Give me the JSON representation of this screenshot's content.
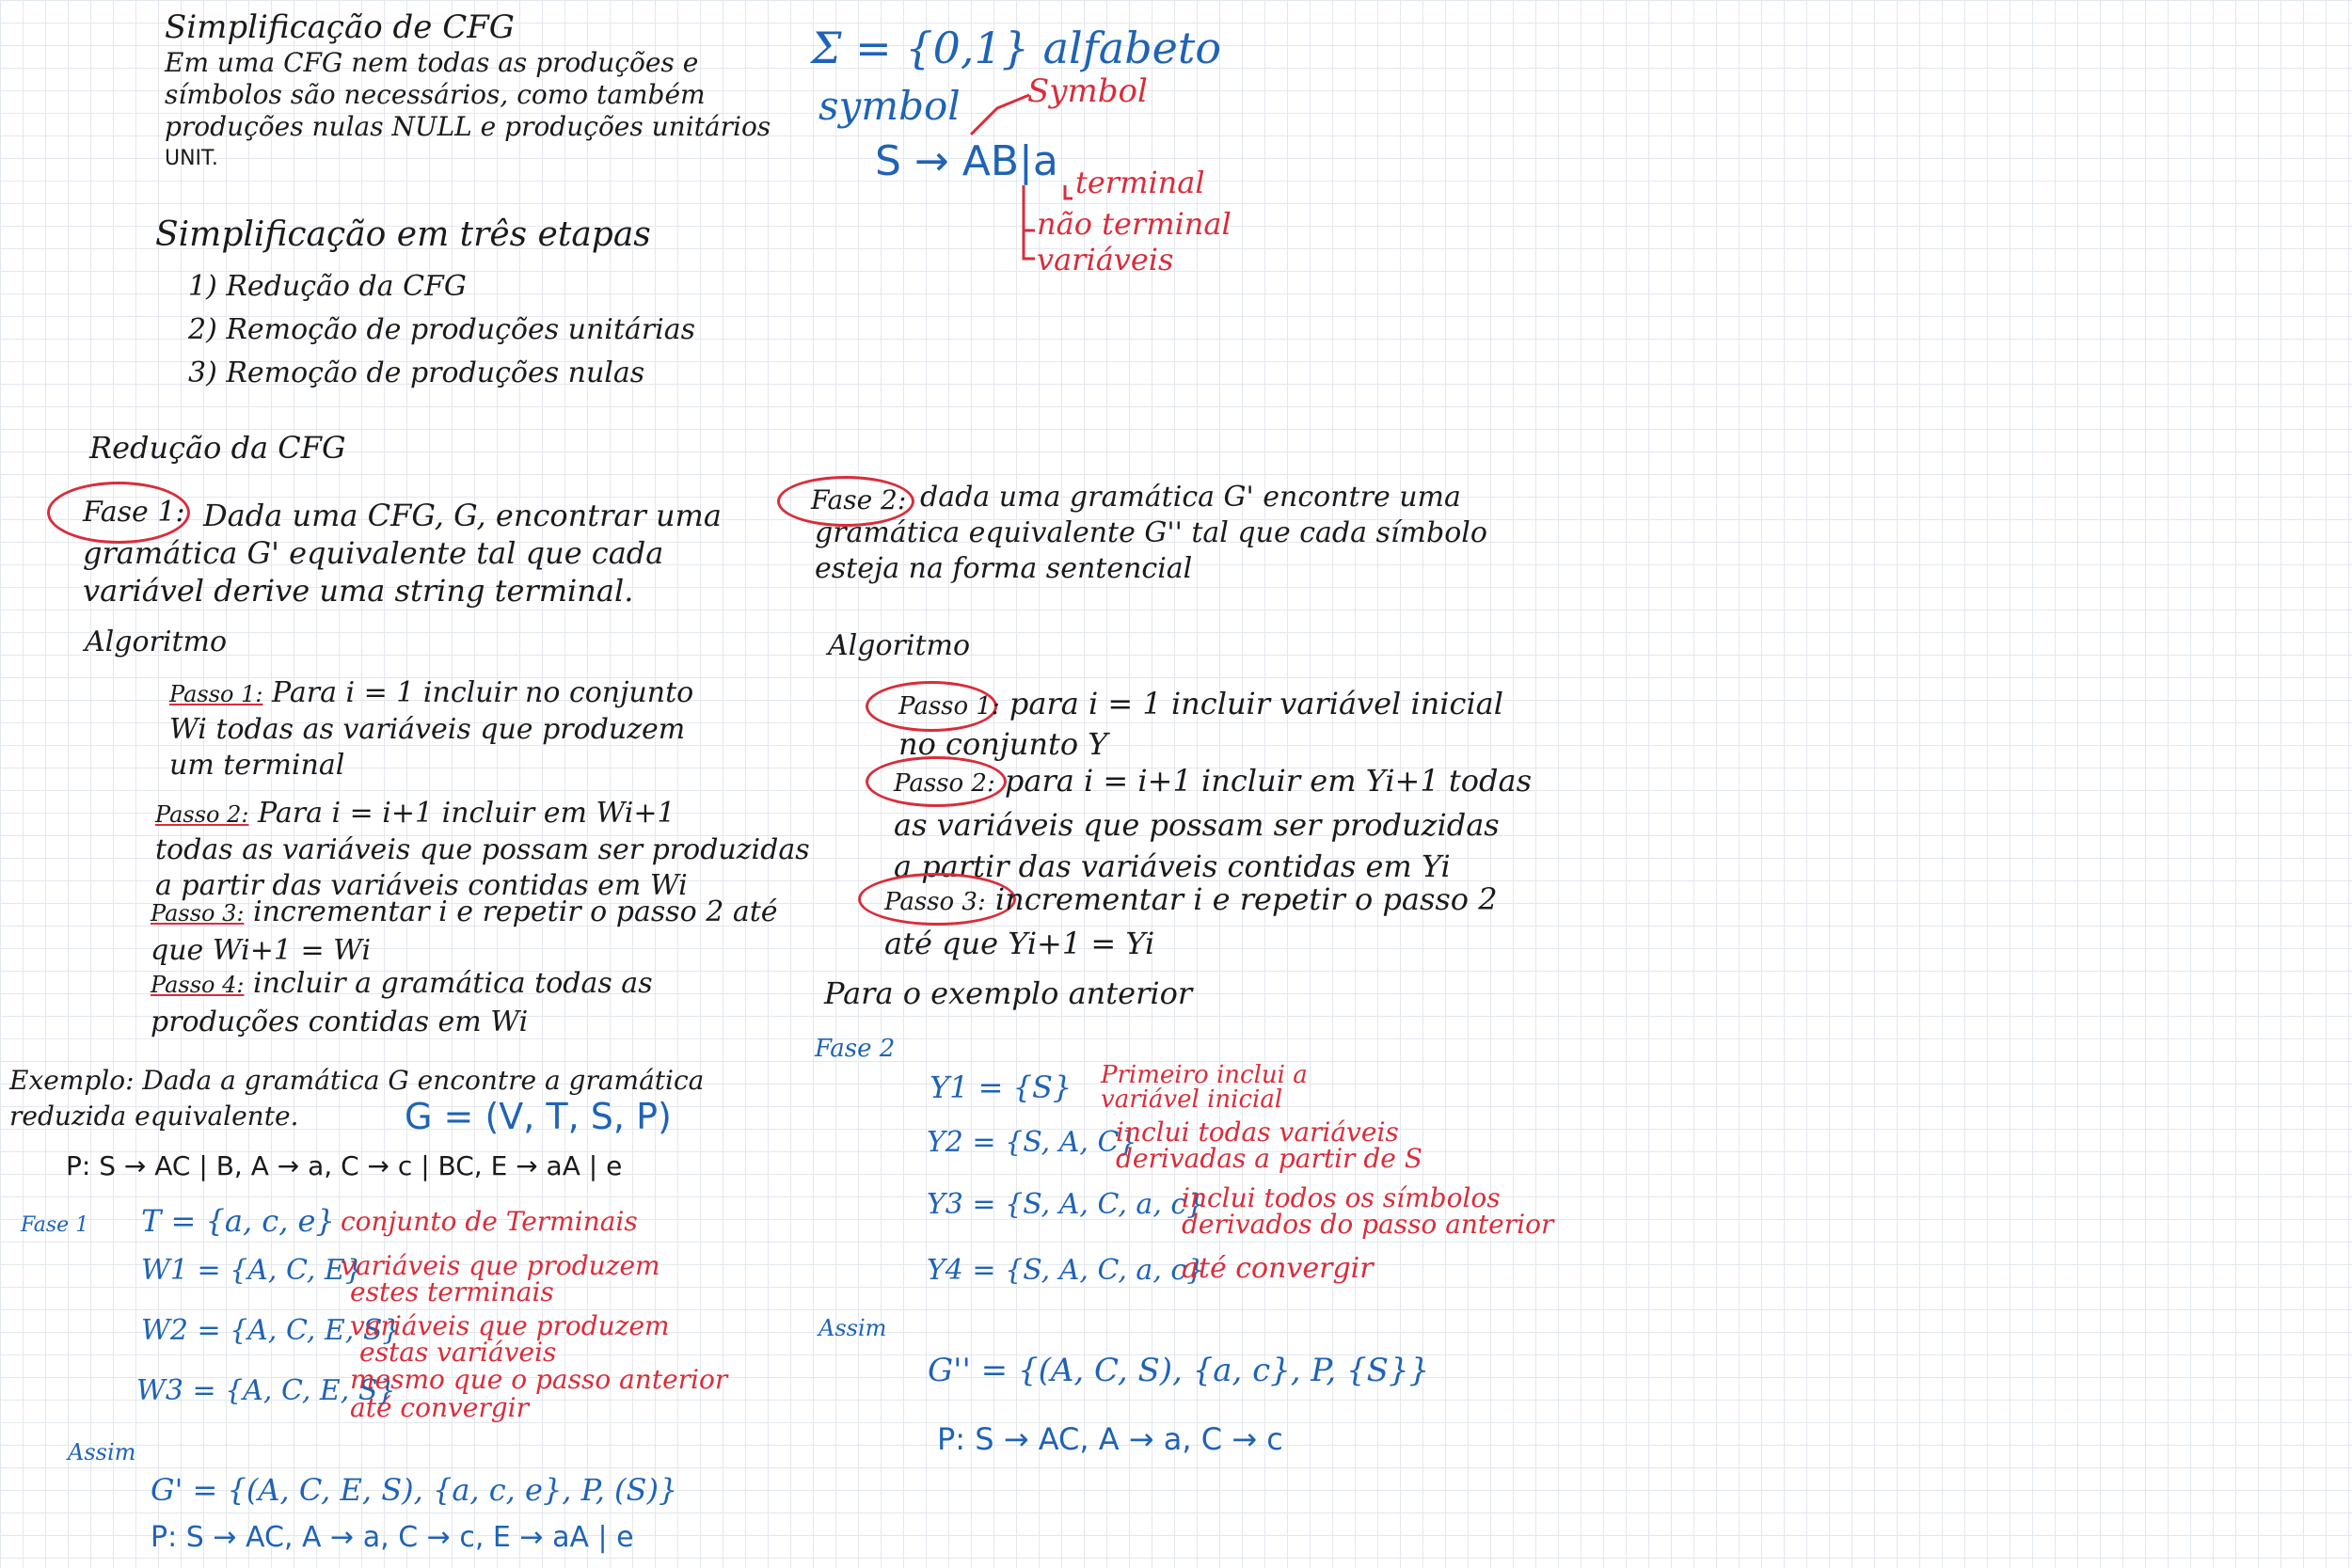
{
  "intro": {
    "title": "Simplificação de CFG",
    "lines": [
      "Em uma CFG nem todas as produções e",
      "símbolos são necessários, como também",
      "produções nulas NULL e produções unitários",
      "UNIT."
    ],
    "steps_heading": "Simplificação em três etapas",
    "steps": [
      "1) Redução da CFG",
      "2) Remoção de produções unitárias",
      "3) Remoção de produções nulas"
    ]
  },
  "legend": {
    "alphabet": "Σ = {0,1} alfabeto",
    "symbol_blue": "symbol",
    "symbol_red": "Symbol",
    "production": "S → AB|a",
    "notes": [
      "terminal",
      "não terminal",
      "variáveis"
    ]
  },
  "reduction": {
    "heading": "Redução da CFG",
    "fase1_label": "Fase 1:",
    "fase1_lines": [
      "Dada uma CFG, G, encontrar uma",
      "gramática G' equivalente tal que cada",
      "variável derive uma string terminal."
    ],
    "algoritmo": "Algoritmo",
    "passos": [
      {
        "label": "Passo 1:",
        "lines": [
          "Para i = 1 incluir no conjunto",
          "Wi todas as variáveis que produzem",
          "um terminal"
        ]
      },
      {
        "label": "Passo 2:",
        "lines": [
          "Para i = i+1 incluir em Wi+1",
          "todas as variáveis que possam ser produzidas",
          "a partir das variáveis contidas em Wi"
        ]
      },
      {
        "label": "Passo 3:",
        "lines": [
          "incrementar i e repetir o passo 2 até",
          "que Wi+1 = Wi"
        ]
      },
      {
        "label": "Passo 4:",
        "lines": [
          "incluir a gramática todas as",
          "produções contidas em Wi"
        ]
      }
    ]
  },
  "example1": {
    "lines": [
      "Exemplo: Dada a gramática G encontre a gramática",
      "reduzida equivalente."
    ],
    "g_def": "G = (V, T, S, P)",
    "productions": "P: S → AC | B, A → a, C → c | BC, E → aA | e",
    "fase_label": "Fase 1",
    "rows": [
      {
        "set": "T = {a, c, e}",
        "note": [
          "conjunto de Terminais"
        ]
      },
      {
        "set": "W1 = {A, C, E}",
        "note": [
          "variáveis que produzem",
          "estes terminais"
        ]
      },
      {
        "set": "W2 = {A, C, E, S}",
        "note": [
          "variáveis que produzem",
          "estas variáveis"
        ]
      },
      {
        "set": "W3 = {A, C, E, S}",
        "note": [
          "mesmo que o passo anterior",
          "até convergir"
        ]
      }
    ],
    "assim": "Assim",
    "result": "G' = {(A, C, E, S), {a, c, e}, P, (S)}",
    "result_p": "P: S → AC, A → a, C → c, E → aA | e"
  },
  "fase2": {
    "label": "Fase 2:",
    "lines": [
      "dada uma gramática G' encontre uma",
      "gramática equivalente G'' tal que cada símbolo",
      "esteja na forma sentencial"
    ],
    "algoritmo": "Algoritmo",
    "passos": [
      {
        "label": "Passo 1:",
        "lines": [
          "para i = 1 incluir variável inicial",
          "no conjunto Y"
        ]
      },
      {
        "label": "Passo 2:",
        "lines": [
          "para i = i+1 incluir em Yi+1 todas",
          "as variáveis que possam ser produzidas",
          "a partir das variáveis contidas em Yi"
        ]
      },
      {
        "label": "Passo 3:",
        "lines": [
          "incrementar i e repetir o passo 2",
          "até que Yi+1 = Yi"
        ]
      }
    ],
    "para_exemplo": "Para o exemplo anterior",
    "fase_label": "Fase 2",
    "rows": [
      {
        "set": "Y1 = {S}",
        "note": [
          "Primeiro inclui a",
          "variável inicial"
        ]
      },
      {
        "set": "Y2 = {S, A, C}",
        "note": [
          "inclui todas variáveis",
          "derivadas a partir de S"
        ]
      },
      {
        "set": "Y3 = {S, A, C, a, c}",
        "note": [
          "inclui todos os símbolos",
          "derivados do passo anterior"
        ]
      },
      {
        "set": "Y4 = {S, A, C, a, c}",
        "note": [
          "até convergir"
        ]
      }
    ],
    "assim": "Assim",
    "result": "G'' = {(A, C, S), {a, c}, P, {S}}",
    "result_p": "P: S → AC, A → a, C → c"
  }
}
